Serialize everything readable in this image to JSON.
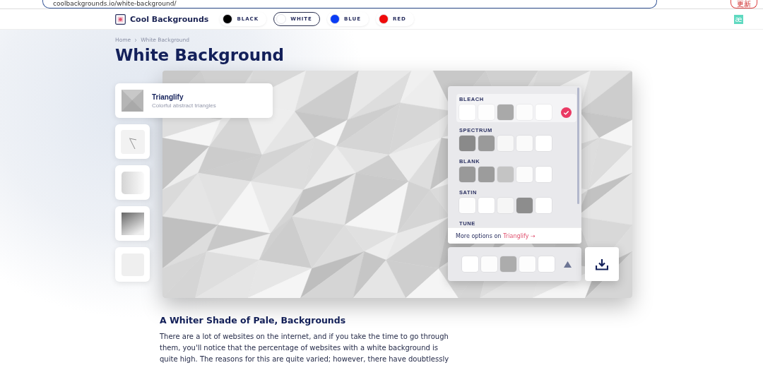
{
  "browser": {
    "url": "coolbackgrounds.io/white-background/",
    "update_button": "更新"
  },
  "header": {
    "logo": "Cool Backgrounds",
    "badge": "æ",
    "colors": [
      {
        "label": "BLACK",
        "color": "#000000",
        "selected": false
      },
      {
        "label": "WHITE",
        "color": "#ffffff",
        "selected": true
      },
      {
        "label": "BLUE",
        "color": "#0a3cf5",
        "selected": false
      },
      {
        "label": "RED",
        "color": "#f00a0a",
        "selected": false
      }
    ]
  },
  "breadcrumb": [
    "Home",
    "White Background"
  ],
  "title": "White Background",
  "generators": [
    {
      "kind": "triangles",
      "title": "Trianglify",
      "subtitle": "Colorful abstract triangles",
      "selected": true
    },
    {
      "kind": "lines",
      "selected": false
    },
    {
      "kind": "gradient",
      "selected": false
    },
    {
      "kind": "dark-gradient",
      "selected": false
    },
    {
      "kind": "blank",
      "selected": false
    }
  ],
  "palettes": [
    {
      "name": "BLEACH",
      "selected": true,
      "swatches": [
        {
          "color": "#ffffff"
        },
        {
          "color": "#fdfdfd"
        },
        {
          "color": "#a9a9a9"
        },
        {
          "color": "#fcfcfc"
        },
        {
          "color": "#ffffff"
        }
      ]
    },
    {
      "name": "SPECTRUM",
      "selected": false,
      "swatches": [
        {
          "color": "#8a8a8a"
        },
        {
          "color": "#9a9a9a"
        },
        {
          "color": "#f7f7f7"
        },
        {
          "color": "#fafafa"
        },
        {
          "color": "#ffffff"
        }
      ]
    },
    {
      "name": "BLANK",
      "selected": false,
      "swatches": [
        {
          "color": "#999999"
        },
        {
          "color": "#9c9c9c"
        },
        {
          "color": "#c4c4c4"
        },
        {
          "color": "#fbfbfb"
        },
        {
          "color": "#ffffff"
        }
      ]
    },
    {
      "name": "SATIN",
      "selected": false,
      "swatches": [
        {
          "color": "#fdfdfd"
        },
        {
          "color": "#ffffff"
        },
        {
          "color": "#f6f6f6"
        },
        {
          "color": "#8d8d8d"
        },
        {
          "color": "#ffffff"
        }
      ]
    },
    {
      "name": "TUNE",
      "selected": false
    }
  ],
  "more_options": {
    "text": "More options on ",
    "link": "Trianglify →"
  },
  "current_swatches": [
    {
      "color": "#ffffff"
    },
    {
      "color": "#fcfcfc"
    },
    {
      "color": "#acacac"
    },
    {
      "color": "#fdfdfd"
    },
    {
      "color": "#ffffff"
    }
  ],
  "article": {
    "heading": "A Whiter Shade of Pale, Backgrounds",
    "paragraph": "There are a lot of websites on the internet, and if you take the time to go through them, you'll notice that the percentage of websites with a white background is quite high. The reasons for this are quite varied; however, there have doubtlessly"
  }
}
